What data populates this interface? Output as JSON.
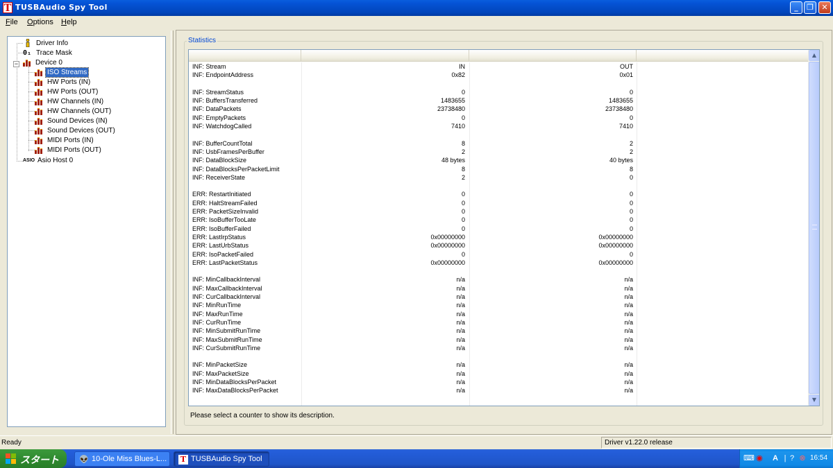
{
  "window": {
    "title": "TUSBAudio Spy Tool",
    "app_icon_letter": "T",
    "controls": {
      "minimize": "_",
      "maximize": "❐",
      "close": "✕"
    }
  },
  "menu": {
    "file": "File",
    "options": "Options",
    "help": "Help"
  },
  "tree": {
    "items": [
      {
        "label": "Driver Info"
      },
      {
        "label": "Trace Mask",
        "icon_text": "0₁"
      },
      {
        "label": "Device  0",
        "expander": "−"
      },
      {
        "label": "ISO Streams"
      },
      {
        "label": "HW Ports (IN)"
      },
      {
        "label": "HW Ports (OUT)"
      },
      {
        "label": "HW Channels (IN)"
      },
      {
        "label": "HW Channels (OUT)"
      },
      {
        "label": "Sound Devices (IN)"
      },
      {
        "label": "Sound Devices (OUT)"
      },
      {
        "label": "MIDI Ports (IN)"
      },
      {
        "label": "MIDI Ports (OUT)"
      },
      {
        "label": "Asio Host 0",
        "icon_text": "ASIO"
      }
    ]
  },
  "statistics": {
    "legend": "Statistics",
    "rows": [
      {
        "name": "INF:  Stream",
        "in": "IN",
        "out": "OUT"
      },
      {
        "name": "INF:  EndpointAddress",
        "in": "0x82",
        "out": "0x01"
      },
      {
        "name": "",
        "in": "",
        "out": ""
      },
      {
        "name": "INF:  StreamStatus",
        "in": "0",
        "out": "0"
      },
      {
        "name": "INF:  BuffersTransferred",
        "in": "1483655",
        "out": "1483655"
      },
      {
        "name": "INF:  DataPackets",
        "in": "23738480",
        "out": "23738480"
      },
      {
        "name": "INF:  EmptyPackets",
        "in": "0",
        "out": "0"
      },
      {
        "name": "INF:  WatchdogCalled",
        "in": "7410",
        "out": "7410"
      },
      {
        "name": "",
        "in": "",
        "out": ""
      },
      {
        "name": "INF:  BufferCountTotal",
        "in": "8",
        "out": "2"
      },
      {
        "name": "INF:  UsbFramesPerBuffer",
        "in": "2",
        "out": "2"
      },
      {
        "name": "INF:  DataBlockSize",
        "in": "48 bytes",
        "out": "40 bytes"
      },
      {
        "name": "INF:  DataBlocksPerPacketLimit",
        "in": "8",
        "out": "8"
      },
      {
        "name": "INF:  ReceiverState",
        "in": "2",
        "out": "0"
      },
      {
        "name": "",
        "in": "",
        "out": ""
      },
      {
        "name": "ERR:  RestartInitiated",
        "in": "0",
        "out": "0"
      },
      {
        "name": "ERR:  HaltStreamFailed",
        "in": "0",
        "out": "0"
      },
      {
        "name": "ERR:  PacketSizeInvalid",
        "in": "0",
        "out": "0"
      },
      {
        "name": "ERR:  IsoBufferTooLate",
        "in": "0",
        "out": "0"
      },
      {
        "name": "ERR:  IsoBufferFailed",
        "in": "0",
        "out": "0"
      },
      {
        "name": "ERR:  LastIrpStatus",
        "in": "0x00000000",
        "out": "0x00000000"
      },
      {
        "name": "ERR:  LastUrbStatus",
        "in": "0x00000000",
        "out": "0x00000000"
      },
      {
        "name": "ERR:  IsoPacketFailed",
        "in": "0",
        "out": "0"
      },
      {
        "name": "ERR:  LastPacketStatus",
        "in": "0x00000000",
        "out": "0x00000000"
      },
      {
        "name": "",
        "in": "",
        "out": ""
      },
      {
        "name": "INF:  MinCallbackInterval",
        "in": "n/a",
        "out": "n/a"
      },
      {
        "name": "INF:  MaxCallbackInterval",
        "in": "n/a",
        "out": "n/a"
      },
      {
        "name": "INF:  CurCallbackInterval",
        "in": "n/a",
        "out": "n/a"
      },
      {
        "name": "INF:  MinRunTime",
        "in": "n/a",
        "out": "n/a"
      },
      {
        "name": "INF:  MaxRunTime",
        "in": "n/a",
        "out": "n/a"
      },
      {
        "name": "INF:  CurRunTime",
        "in": "n/a",
        "out": "n/a"
      },
      {
        "name": "INF:  MinSubmitRunTime",
        "in": "n/a",
        "out": "n/a"
      },
      {
        "name": "INF:  MaxSubmitRunTime",
        "in": "n/a",
        "out": "n/a"
      },
      {
        "name": "INF:  CurSubmitRunTime",
        "in": "n/a",
        "out": "n/a"
      },
      {
        "name": "",
        "in": "",
        "out": ""
      },
      {
        "name": "INF:  MinPacketSize",
        "in": "n/a",
        "out": "n/a"
      },
      {
        "name": "INF:  MaxPacketSize",
        "in": "n/a",
        "out": "n/a"
      },
      {
        "name": "INF:  MinDataBlocksPerPacket",
        "in": "n/a",
        "out": "n/a"
      },
      {
        "name": "INF:  MaxDataBlocksPerPacket",
        "in": "n/a",
        "out": "n/a"
      }
    ],
    "description": "Please select a counter to show its description."
  },
  "scrollbar": {
    "up_arrow": "▲",
    "down_arrow": "▼"
  },
  "statusbar": {
    "left": "Ready",
    "right": "Driver v1.22.0 release"
  },
  "taskbar": {
    "start_label": "スタート",
    "tasks": [
      {
        "label": "10-Ole Miss Blues-L...",
        "icon": "👽"
      },
      {
        "label": "TUSBAudio Spy Tool",
        "icon": "T"
      }
    ],
    "tray": {
      "ime_label": "A",
      "clock": "16:54"
    }
  },
  "colors": {
    "selection": "#316ac5",
    "legend_text": "#0046d5",
    "titlebar": "#0145ba",
    "taskbar": "#245edb",
    "start": "#2f8b2f"
  }
}
